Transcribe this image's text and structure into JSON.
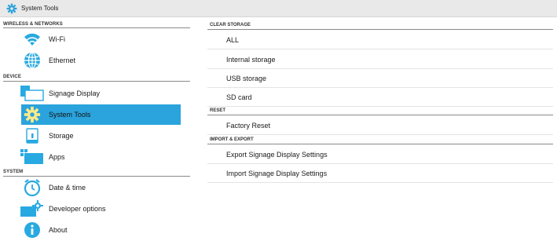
{
  "window": {
    "title": "System Tools"
  },
  "sidebar": {
    "sections": [
      {
        "header": "WIRELESS & NETWORKS"
      },
      {
        "header": "DEVICE"
      },
      {
        "header": "SYSTEM"
      }
    ],
    "items": [
      {
        "label": "Wi-Fi",
        "icon": "wifi-icon"
      },
      {
        "label": "Ethernet",
        "icon": "globe-icon"
      },
      {
        "label": "Signage Display",
        "icon": "display-icon"
      },
      {
        "label": "System Tools",
        "icon": "gear-icon",
        "selected": true
      },
      {
        "label": "Storage",
        "icon": "storage-icon"
      },
      {
        "label": "Apps",
        "icon": "apps-icon"
      },
      {
        "label": "Date & time",
        "icon": "clock-icon"
      },
      {
        "label": "Developer options",
        "icon": "developer-icon"
      },
      {
        "label": "About",
        "icon": "info-icon"
      }
    ]
  },
  "content": {
    "sections": [
      {
        "header": "CLEAR STORAGE",
        "items": [
          "ALL",
          "Internal storage",
          "USB storage",
          "SD card"
        ]
      },
      {
        "header": "RESET",
        "items": [
          "Factory Reset"
        ]
      },
      {
        "header": "IMPORT & EXPORT",
        "items": [
          "Export Signage Display Settings",
          "Import Signage Display Settings"
        ]
      }
    ]
  },
  "colors": {
    "accent": "#2ba3dc",
    "title_bar": "#e9e9e9",
    "icon_blue": "#29a9e1"
  }
}
